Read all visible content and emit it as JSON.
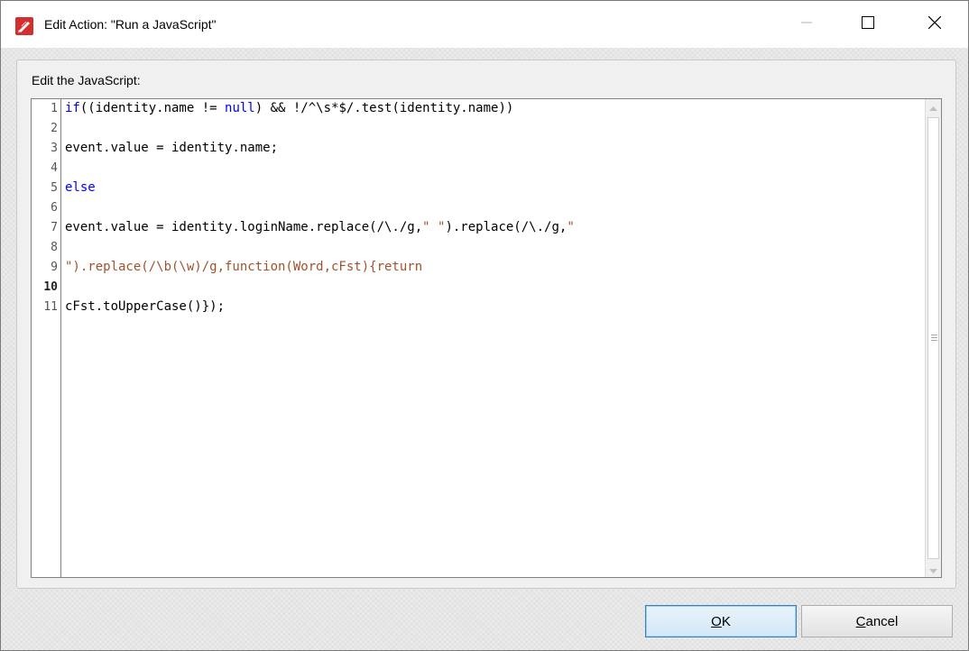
{
  "window": {
    "title": "Edit Action: \"Run a JavaScript\"",
    "app_icon": "pdf-pen-icon",
    "controls": [
      "minimize-icon",
      "maximize-icon",
      "close-icon"
    ]
  },
  "panel": {
    "label": "Edit the JavaScript:"
  },
  "editor": {
    "line_numbers": [
      "1",
      "2",
      "3",
      "4",
      "5",
      "6",
      "7",
      "8",
      "9",
      "10",
      "11"
    ],
    "lines": [
      {
        "n": "1",
        "segments": [
          {
            "t": "if",
            "c": "kw"
          },
          {
            "t": "((identity.name != ",
            "c": "plain"
          },
          {
            "t": "null",
            "c": "kw"
          },
          {
            "t": ") && !/^\\s*$/.test(identity.name))",
            "c": "plain"
          }
        ]
      },
      {
        "n": "3",
        "segments": [
          {
            "t": "event.value = identity.name;",
            "c": "plain"
          }
        ]
      },
      {
        "n": "5",
        "segments": [
          {
            "t": "else",
            "c": "kw"
          }
        ]
      },
      {
        "n": "7",
        "segments": [
          {
            "t": "event.value = identity.loginName.replace(/\\./g,",
            "c": "plain"
          },
          {
            "t": "\" \"",
            "c": "str"
          },
          {
            "t": ").replace(/\\./g,",
            "c": "plain"
          },
          {
            "t": "\"",
            "c": "str"
          }
        ]
      },
      {
        "n": "9",
        "segments": [
          {
            "t": "\").replace(/\\b(\\w)/g,function(Word,cFst){return",
            "c": "str"
          }
        ]
      },
      {
        "n": "11",
        "segments": [
          {
            "t": "cFst.toUpperCase()});",
            "c": "plain"
          }
        ]
      }
    ]
  },
  "buttons": {
    "ok_underline": "O",
    "ok_rest": "K",
    "cancel_underline": "C",
    "cancel_rest": "ancel"
  },
  "colors": {
    "keyword": "#0000ff",
    "text": "#000000",
    "string": "#a0522d",
    "titlebar_icon": "#d32f2f"
  }
}
